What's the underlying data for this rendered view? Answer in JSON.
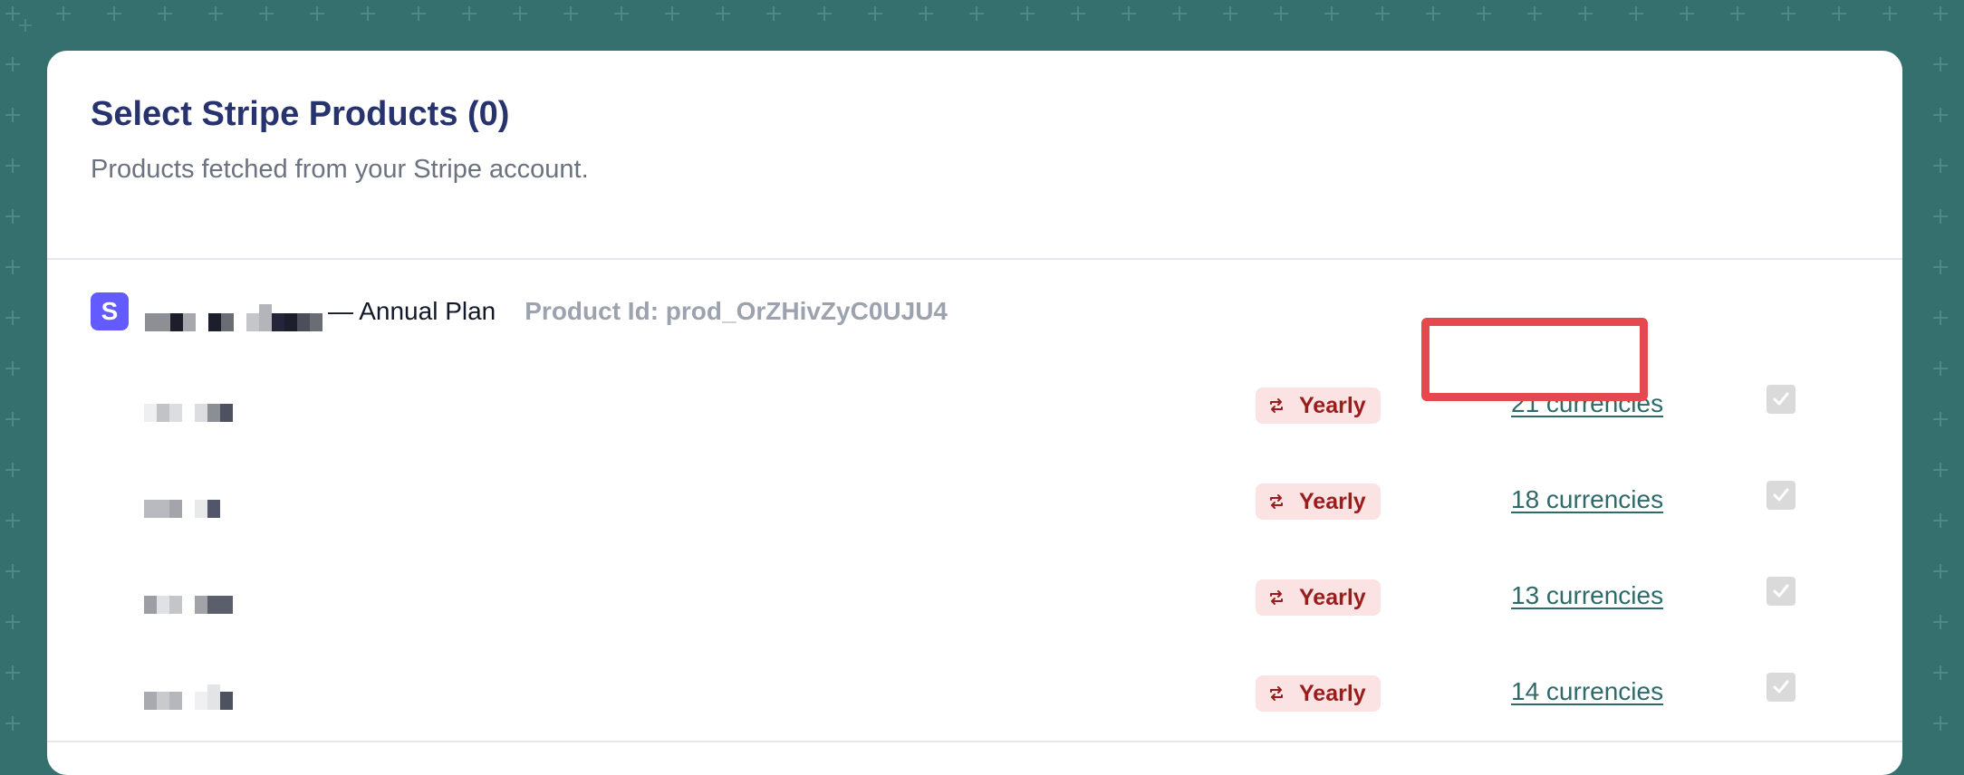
{
  "header": {
    "title": "Select Stripe Products (0)",
    "subtitle": "Products fetched from your Stripe account."
  },
  "product": {
    "logo_letter": "S",
    "name_suffix": "— Annual Plan",
    "product_id": "Product Id: prod_OrZHivZyC0UJU4"
  },
  "prices": [
    {
      "interval": "Yearly",
      "currencies": "21 currencies",
      "checked": true,
      "highlighted": true
    },
    {
      "interval": "Yearly",
      "currencies": "18 currencies",
      "checked": true,
      "highlighted": false
    },
    {
      "interval": "Yearly",
      "currencies": "13 currencies",
      "checked": true,
      "highlighted": false
    },
    {
      "interval": "Yearly",
      "currencies": "14 currencies",
      "checked": true,
      "highlighted": false
    }
  ],
  "icons": {
    "logo": "stripe-logo-icon",
    "badge": "recurring-arrows-icon",
    "checkbox": "checkmark-icon"
  },
  "colors": {
    "background": "#356f6e",
    "title": "#27336e",
    "stripe": "#635bff",
    "badge_bg": "#fbe3e3",
    "badge_text": "#9b1c1c",
    "link": "#2f6a6a",
    "highlight": "#e5484d"
  }
}
